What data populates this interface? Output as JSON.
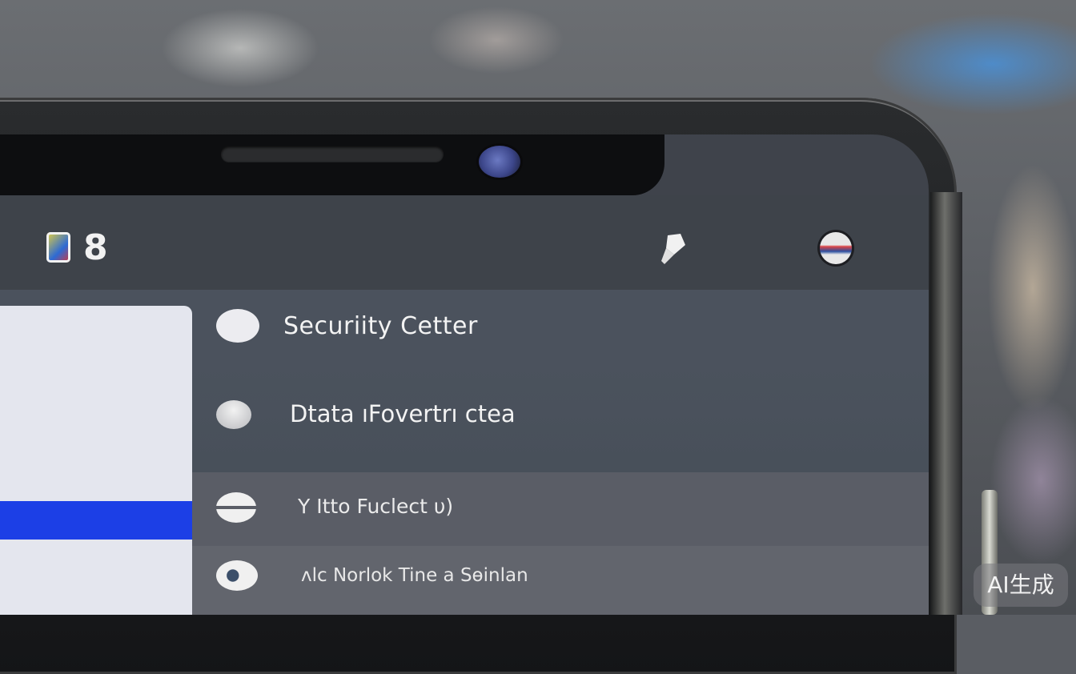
{
  "status_bar": {
    "number": "8",
    "app_icon": "app-icon",
    "right_icons": [
      "brush-icon",
      "avatar-icon"
    ]
  },
  "menu": {
    "items": [
      {
        "label": "Securiity Cetter",
        "icon": "circle-icon"
      },
      {
        "label": "Dtata ıFovertrı ctea",
        "icon": "pin-icon"
      },
      {
        "label": "Υ Itto Fuclect υ)",
        "icon": "toggle-icon"
      },
      {
        "label": "ʌlc Norlok Tine a Sɵinlan",
        "icon": "eye-icon"
      }
    ]
  },
  "watermark": "AI生成",
  "colors": {
    "screen_bg": "#3f434b",
    "accent_bar": "#1c3fe6",
    "side_panel": "#e4e6ee"
  }
}
